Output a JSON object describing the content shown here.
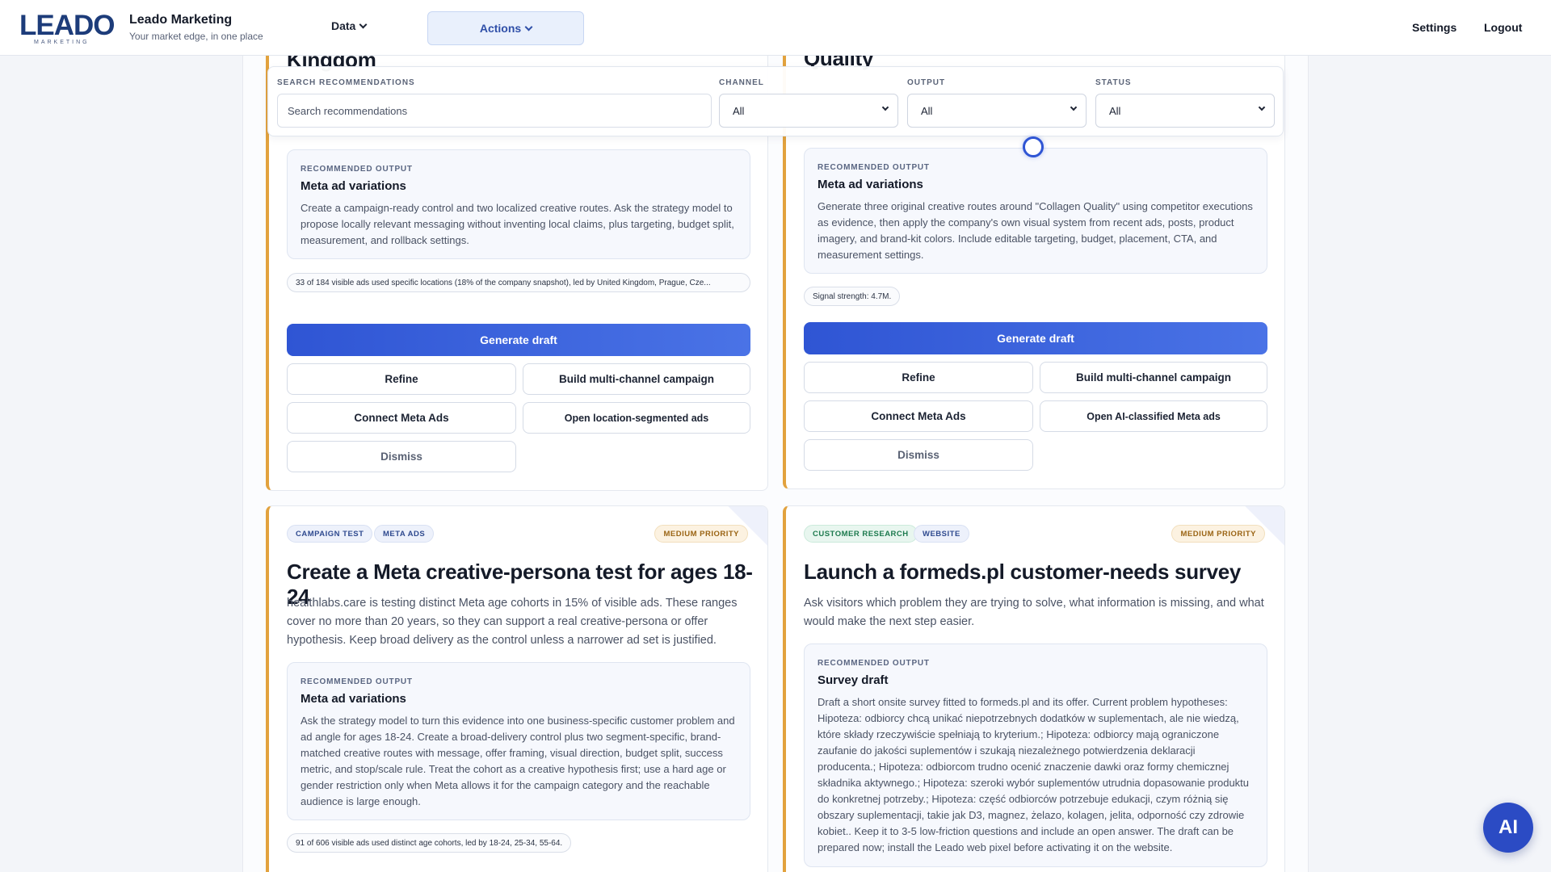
{
  "header": {
    "logo_text": "LEADO",
    "logo_sub": "MARKETING",
    "brand_name": "Leado Marketing",
    "brand_tagline": "Your market edge, in one place",
    "nav_data": "Data",
    "nav_actions": "Actions",
    "settings": "Settings",
    "logout": "Logout"
  },
  "filters": {
    "search_label": "SEARCH RECOMMENDATIONS",
    "search_placeholder": "Search recommendations",
    "channel_label": "CHANNEL",
    "channel_value": "All",
    "output_label": "OUTPUT",
    "output_value": "All",
    "status_label": "STATUS",
    "status_value": "All"
  },
  "cards": [
    {
      "title_fragment": "Kingdom",
      "rec_label": "RECOMMENDED OUTPUT",
      "rec_title": "Meta ad variations",
      "rec_body": "Create a campaign-ready control and two localized creative routes. Ask the strategy model to propose locally relevant messaging without inventing local claims, plus targeting, budget split, measurement, and rollback settings.",
      "signal": "33 of 184 visible ads used specific locations (18% of the company snapshot), led by United Kingdom, Prague, Cze...",
      "generate": "Generate draft",
      "refine": "Refine",
      "multi_channel": "Build multi-channel campaign",
      "connect": "Connect Meta Ads",
      "open": "Open location-segmented ads",
      "dismiss": "Dismiss"
    },
    {
      "title_fragment": "Quality",
      "rec_label": "RECOMMENDED OUTPUT",
      "rec_title": "Meta ad variations",
      "rec_body": "Generate three original creative routes around \"Collagen Quality\" using competitor executions as evidence, then apply the company's own visual system from recent ads, posts, product imagery, and brand-kit colors. Include editable targeting, budget, placement, CTA, and measurement settings.",
      "signal": "Signal strength: 4.7M.",
      "generate": "Generate draft",
      "refine": "Refine",
      "multi_channel": "Build multi-channel campaign",
      "connect": "Connect Meta Ads",
      "open": "Open AI-classified Meta ads",
      "dismiss": "Dismiss"
    },
    {
      "tags": [
        "CAMPAIGN TEST",
        "META ADS"
      ],
      "priority": "MEDIUM PRIORITY",
      "title": "Create a Meta creative-persona test for ages 18-24",
      "desc": "healthlabs.care is testing distinct Meta age cohorts in 15% of visible ads. These ranges cover no more than 20 years, so they can support a real creative-persona or offer hypothesis. Keep broad delivery as the control unless a narrower ad set is justified.",
      "rec_label": "RECOMMENDED OUTPUT",
      "rec_title": "Meta ad variations",
      "rec_body": "Ask the strategy model to turn this evidence into one business-specific customer problem and ad angle for ages 18-24. Create a broad-delivery control plus two segment-specific, brand-matched creative routes with message, offer framing, visual direction, budget split, success metric, and stop/scale rule. Treat the cohort as a creative hypothesis first; use a hard age or gender restriction only when Meta allows it for the campaign category and the reachable audience is large enough.",
      "signal": "91 of 606 visible ads used distinct age cohorts, led by 18-24, 25-34, 55-64."
    },
    {
      "tags": [
        "CUSTOMER RESEARCH",
        "WEBSITE"
      ],
      "priority": "MEDIUM PRIORITY",
      "title": "Launch a formeds.pl customer-needs survey",
      "desc": "Ask visitors which problem they are trying to solve, what information is missing, and what would make the next step easier.",
      "rec_label": "RECOMMENDED OUTPUT",
      "rec_title": "Survey draft",
      "rec_body": "Draft a short onsite survey fitted to formeds.pl and its offer. Current problem hypotheses: Hipoteza: odbiorcy chcą unikać niepotrzebnych dodatków w suplementach, ale nie wiedzą, które składy rzeczywiście spełniają to kryterium.; Hipoteza: odbiorcy mają ograniczone zaufanie do jakości suplementów i szukają niezależnego potwierdzenia deklaracji producenta.; Hipoteza: odbiorcom trudno ocenić znaczenie dawki oraz formy chemicznej składnika aktywnego.; Hipoteza: szeroki wybór suplementów utrudnia dopasowanie produktu do konkretnej potrzeby.; Hipoteza: część odbiorców potrzebuje edukacji, czym różnią się obszary suplementacji, takie jak D3, magnez, żelazo, kolagen, jelita, odporność czy zdrowie kobiet.. Keep it to 3-5 low-friction questions and include an open answer. The draft can be prepared now; install the Leado web pixel before activating it on the website."
    }
  ],
  "ai_button": "AI",
  "colors": {
    "accent": "#2f55d4",
    "priority_border": "#e2a23e",
    "brand": "#1d3c7a"
  }
}
